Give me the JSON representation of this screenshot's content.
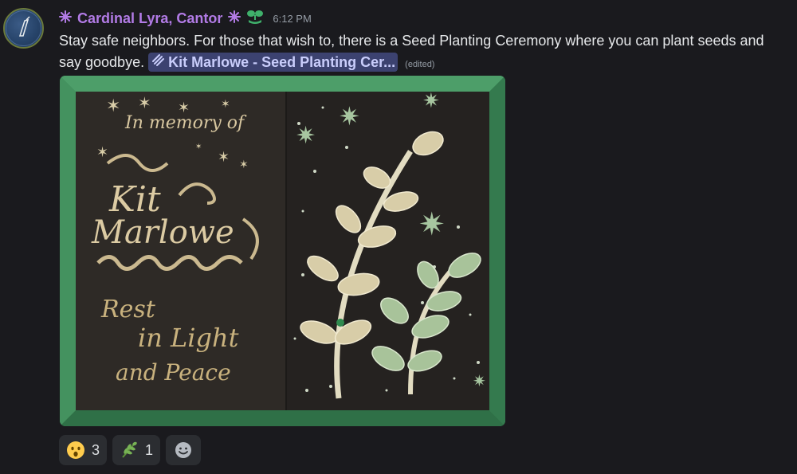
{
  "author": {
    "name": "Cardinal Lyra, Cantor",
    "timestamp": "6:12 PM"
  },
  "message": {
    "text": "Stay safe neighbors. For those that wish to, there is a Seed Planting Ceremony where you can plant seeds and say goodbye.",
    "link_label": "Kit Marlowe - Seed Planting Cer...",
    "edited_label": "(edited)"
  },
  "image": {
    "left_heading": "In memory of",
    "name_line1": "Kit",
    "name_line2": "Marlowe",
    "rest_line1": "Rest",
    "rest_line2": "in Light",
    "rest_line3": "and Peace"
  },
  "reactions": [
    {
      "emoji": "hushed-face",
      "count": "3"
    },
    {
      "emoji": "herb",
      "count": "1"
    }
  ],
  "colors": {
    "username": "#b27be6",
    "frame_green": "#3c8a57",
    "link_bg": "#3c4270"
  }
}
